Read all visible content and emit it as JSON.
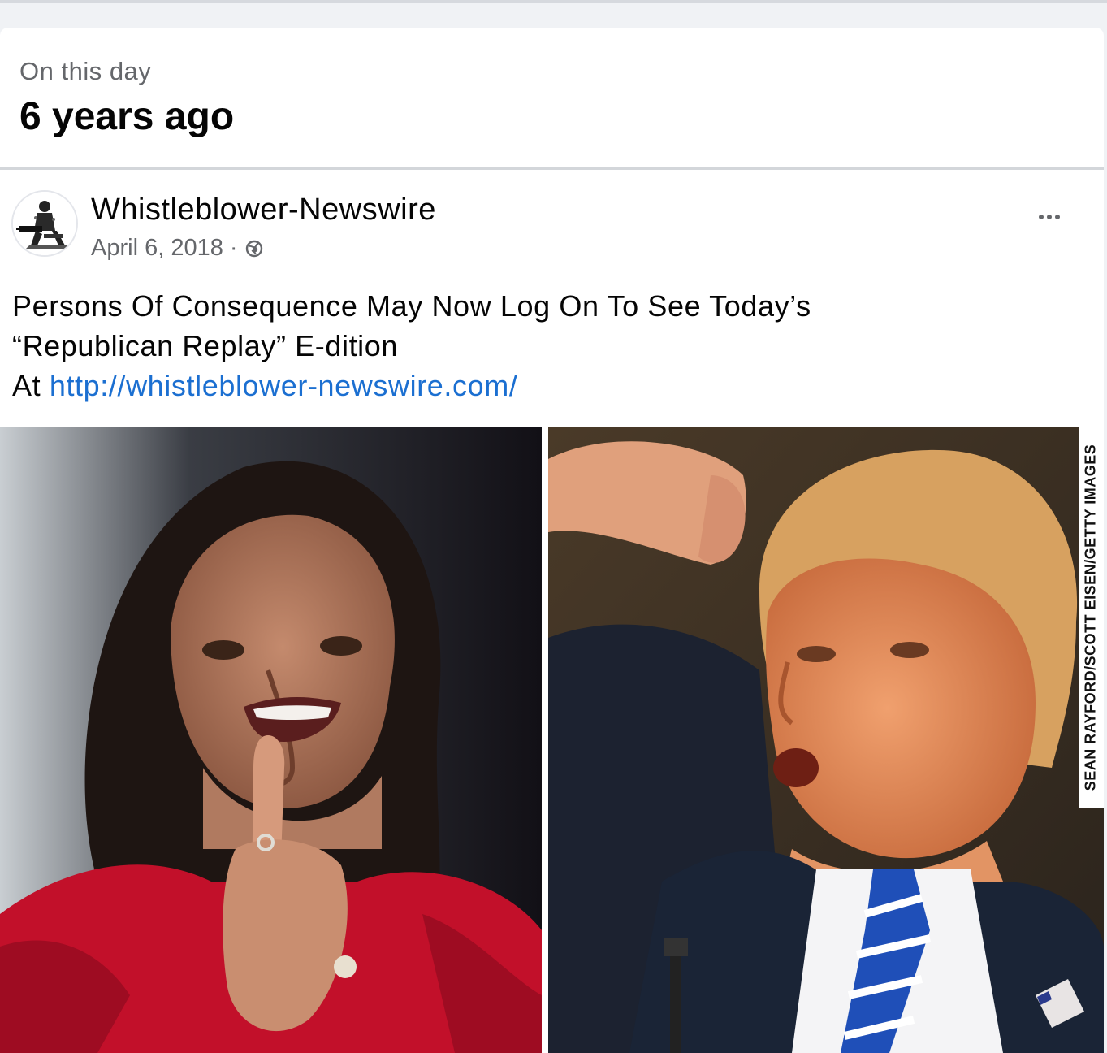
{
  "memory": {
    "kicker": "On this day",
    "title": "6 years ago"
  },
  "post": {
    "author": "Whistleblower-Newswire",
    "date": "April 6, 2018",
    "separator": "·",
    "privacy_icon": "globe-icon",
    "text_line1": "Persons Of Consequence May Now Log On To See Today’s",
    "text_line2": "“Republican Replay” E-dition",
    "text_prefix": "At ",
    "link": "http://whistleblower-newswire.com/",
    "more_icon": "more-options-icon"
  },
  "photo": {
    "credit": "SEAN RAYFORD/SCOTT EISEN/GETTY IMAGES"
  },
  "colors": {
    "link": "#1b6fd1",
    "secondary_text": "#65676b",
    "primary_text": "#050505",
    "page_background": "#f0f2f5"
  }
}
